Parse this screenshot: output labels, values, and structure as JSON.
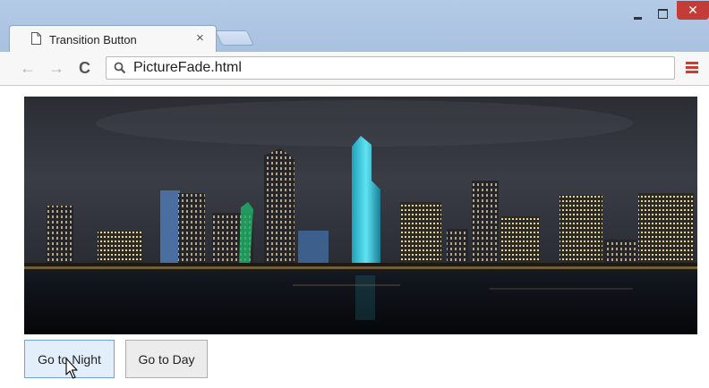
{
  "browser": {
    "tab_title": "Transition Button",
    "tab_close_glyph": "×",
    "address": "PictureFade.html",
    "window_close_glyph": "✕",
    "back_glyph": "←",
    "forward_glyph": "→",
    "reload_glyph": "C"
  },
  "page": {
    "image_subject": "night city skyline",
    "buttons": [
      {
        "label": "Go to Night"
      },
      {
        "label": "Go to Day"
      }
    ]
  },
  "colors": {
    "frame": "#aec6e4",
    "close_button": "#c43c37",
    "menu_icon": "#d23a2e",
    "night_button_bg": "#e3eefb",
    "night_button_border": "#6fa3d8"
  }
}
